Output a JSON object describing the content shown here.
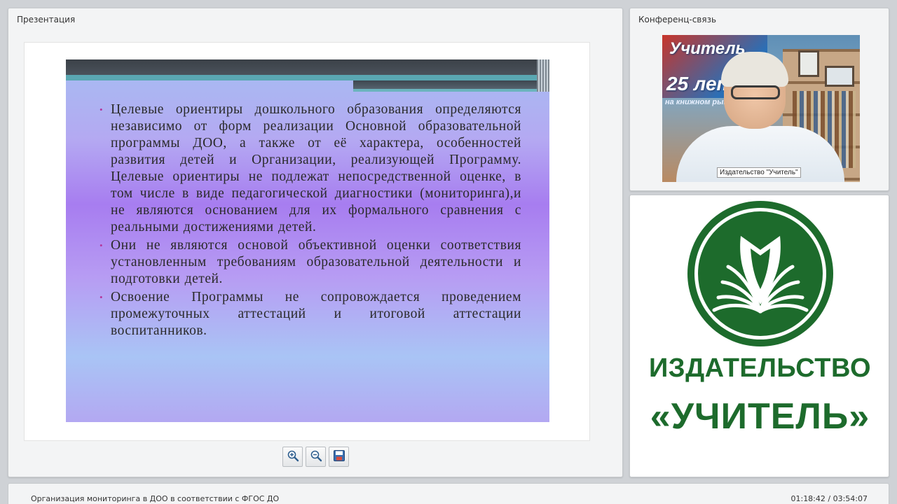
{
  "presentation": {
    "title": "Презентация",
    "slide": {
      "bullets": [
        "Целевые ориентиры дошкольного образования определяются независимо от форм реализации Основной образовательной программы ДОО, а также от её характера, особенностей развития детей и Организации, реализующей Программу. Целевые ориентиры не подлежат непосредственной оценке, в том числе в виде педагогической диагностики (мониторинга),и не являются основанием для их формального сравнения с реальными достижениями детей.",
        "Они не являются основой объективной оценки соответствия установленным требованиям образовательной деятельности и подготовки детей.",
        "Освоение Программы не сопровождается проведением промежуточных аттестаций и итоговой аттестации воспитанников."
      ],
      "bullet_symbol": "•"
    },
    "toolbar": {
      "buttons": [
        "zoom-in-icon",
        "zoom-out-icon",
        "save-icon"
      ]
    }
  },
  "conference": {
    "title": "Конференц-связь",
    "video": {
      "background_banner": "Учитель",
      "background_banner_25": "25 лет",
      "background_banner_sub": "на книжном рынке России",
      "participant_label": "Издательство \"Учитель\""
    }
  },
  "logo": {
    "publisher_line": "ИЗДАТЕЛЬСТВО",
    "name_line": "«УЧИТЕЛЬ»",
    "color": "#1d6b2c"
  },
  "status": {
    "webinar_title": "Организация мониторинга в ДОО в соответствии с ФГОС ДО",
    "time": "01:18:42 / 03:54:07"
  },
  "colors": {
    "bullet": "#b4369b",
    "slide_bar": "#3b4148",
    "slide_accent": "#5aa7b2"
  }
}
